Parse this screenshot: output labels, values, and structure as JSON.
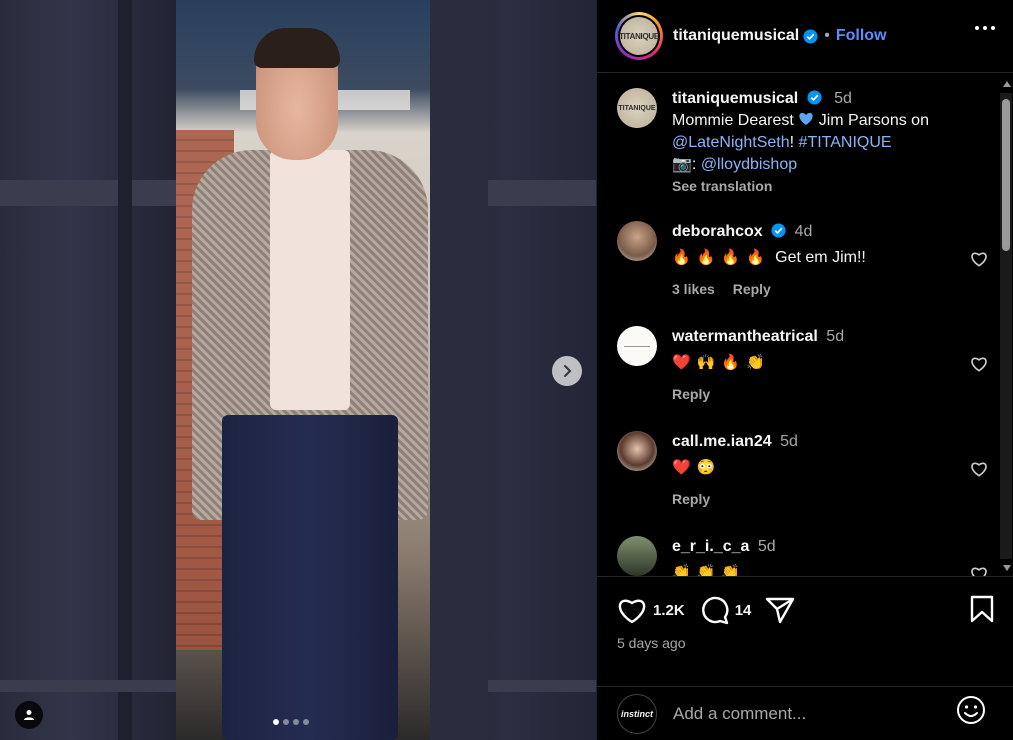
{
  "post": {
    "account": "titaniquemusical",
    "avatar_text": "TITANIQUE",
    "follow_label": "Follow",
    "separator": "•"
  },
  "caption": {
    "user": "titaniquemusical",
    "age": "5d",
    "text_1": "Mommie Dearest ",
    "text_2": " Jim Parsons on",
    "mention_1": "@LateNightSeth",
    "text_3": "! ",
    "hashtag": "#TITANIQUE",
    "camera": "📷",
    "text_4": ": ",
    "mention_2": "@lloydbishop",
    "see_translation": "See translation"
  },
  "comments": [
    {
      "user": "deborahcox",
      "verified": true,
      "age": "4d",
      "emoji": "🔥🔥🔥🔥",
      "text": "Get em Jim!!",
      "likes": "3 likes",
      "reply": "Reply"
    },
    {
      "user": "watermantheatrical",
      "verified": false,
      "age": "5d",
      "emoji": "❤️🙌🔥👏",
      "text": "",
      "reply": "Reply"
    },
    {
      "user": "call.me.ian24",
      "verified": false,
      "age": "5d",
      "emoji": "❤️😳",
      "text": "",
      "reply": "Reply"
    },
    {
      "user": "e_r_i._c_a",
      "verified": false,
      "age": "5d",
      "emoji": "👏👏👏",
      "text": ""
    }
  ],
  "actions": {
    "likes": "1.2K",
    "comments": "14",
    "time": "5 days ago"
  },
  "add_comment": {
    "avatar_text": "instinct",
    "placeholder": "Add a comment..."
  },
  "carousel": {
    "count": 4,
    "active": 0
  },
  "colors": {
    "accent": "#5d8dfd",
    "link": "#8ab4f8",
    "verified": "#0095f6"
  }
}
